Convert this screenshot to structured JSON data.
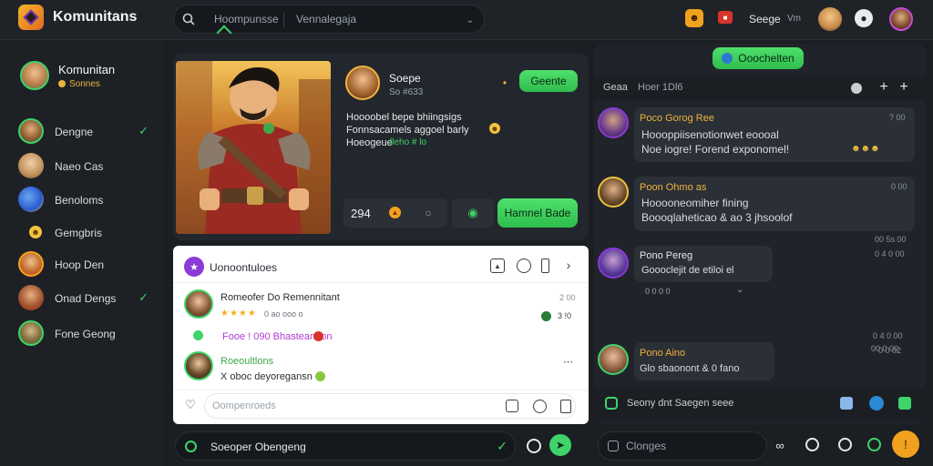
{
  "app": {
    "brand": "Komunitans",
    "search_text": "Hoompunsse",
    "search_filter": "Vennalegaja"
  },
  "topbar": {
    "user_label": "Seege",
    "user_sub": "Vm"
  },
  "sidebar": {
    "profile_name": "Komunitan",
    "profile_status": "Sonnes",
    "items": [
      {
        "label": "Dengne",
        "checked": true
      },
      {
        "label": "Naeo Cas",
        "checked": false
      },
      {
        "label": "Benoloms",
        "checked": false
      },
      {
        "label": "Gemgbris",
        "checked": false
      },
      {
        "label": "Hoop Den",
        "checked": false
      },
      {
        "label": "Onad Dengs",
        "checked": true
      },
      {
        "label": "Fone Geong",
        "checked": false
      }
    ]
  },
  "hero": {
    "name": "Soepe",
    "handle": "So #633",
    "follow_label": "Geente",
    "bio_line1": "Hoooobel bepe bhiingsigs",
    "bio_line2": "Fonnsacamels aggoel barly",
    "bio_line3": "Hoeogeue",
    "bio_tag": "lleho # lo",
    "stat": "294",
    "action_label": "Hamnel Bade"
  },
  "post_panel": {
    "title": "Uonoontuloes",
    "comment1_name": "Romeofer Do Remennitant",
    "comment1_meta": "0 ao  ooo  o",
    "comment1_time": "2 00",
    "comment1_count": "3 !0",
    "link_text": "Fooe ! 090 Bhasteannon",
    "comment2_name": "Roeoultlons",
    "comment2_text": "X oboc deyoregansn",
    "comment_placeholder": "Oompenroeds"
  },
  "bottom_left": {
    "input_text": "Soeoper Obengeng"
  },
  "right_panel": {
    "top_button": "Ooochelten",
    "header_left": "Geaa",
    "header_right": "Hoer 1Dl6",
    "messages": [
      {
        "name": "Poco Gorog Ree",
        "line1": "Hoooppiisenotionwet eoooal",
        "line2": "Noe iogre! Forend exponomel!",
        "time": "? 00"
      },
      {
        "name": "Poon Ohmo as",
        "line1": "Hooooneomiher fining",
        "line2": "Boooqlaheticao & ao 3 jhsoolof",
        "time": "0 00"
      },
      {
        "name": "Pono Pereg",
        "line1": "Goooclejit de etiloi el",
        "line2": "",
        "time": "0 4 0 00"
      },
      {
        "name": "Pono Aino",
        "line1": "Glo sbaonont & 0 fano",
        "line2": "",
        "time": "0 0 02"
      }
    ],
    "time_marks": [
      "00 5s 00",
      "0 4  0 00",
      "00 0 00"
    ],
    "divider_text": "0 0 0  0",
    "compose_text": "Seony dnt Saegen seee",
    "bottom_input": "Clonges"
  },
  "colors": {
    "accent": "#3fd36a",
    "gold": "#f0b23e",
    "orange": "#f2a11e",
    "bg": "#1b1f24"
  }
}
